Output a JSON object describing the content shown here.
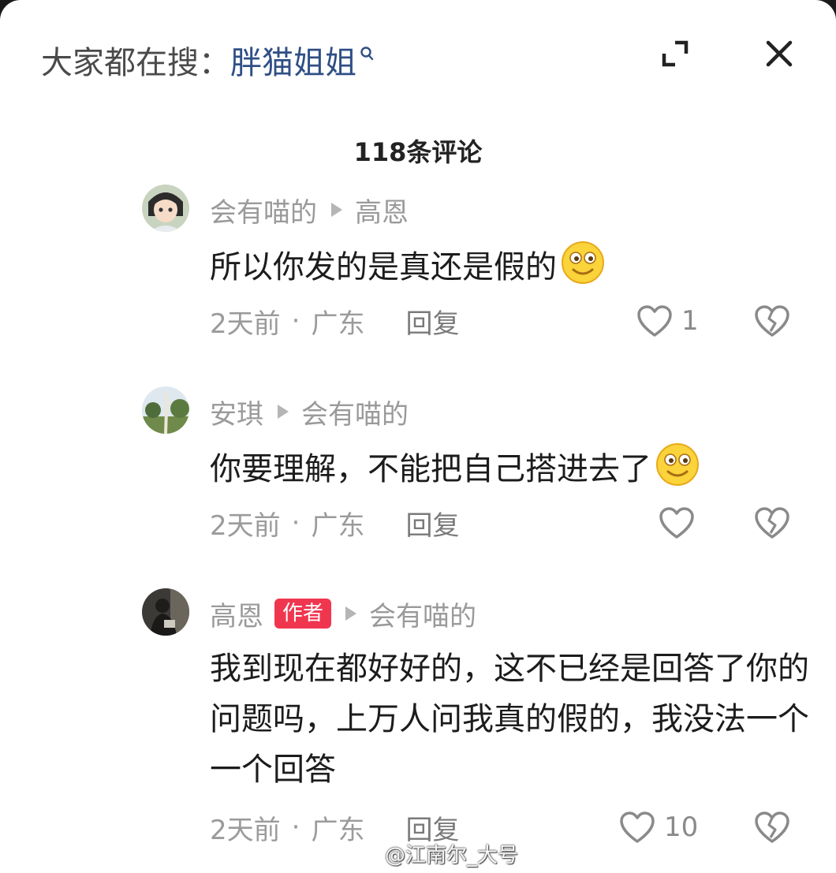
{
  "header": {
    "search_prefix": "大家都在搜：",
    "search_keyword": "胖猫姐姐"
  },
  "comment_count_title": "118条评论",
  "comments": [
    {
      "author": "会有喵的",
      "reply_to": "高恩",
      "text": "所以你发的是真还是假的",
      "time": "2天前",
      "location": "广东",
      "reply_label": "回复",
      "likes": "1",
      "avatar_icon": "anime-girl-avatar"
    },
    {
      "author": "安琪",
      "reply_to": "会有喵的",
      "text": "你要理解，不能把自己搭进去了",
      "time": "2天前",
      "location": "广东",
      "reply_label": "回复",
      "likes": "",
      "avatar_icon": "tree-landscape-avatar"
    },
    {
      "author": "高恩",
      "badge": "作者",
      "reply_to": "会有喵的",
      "text": "我到现在都好好的，这不已经是回答了你的问题吗，上万人问我真的假的，我没法一个一个回答",
      "time": "2天前",
      "location": "广东",
      "reply_label": "回复",
      "likes": "10",
      "avatar_icon": "dark-photo-avatar"
    }
  ],
  "separator": "·",
  "watermark": "@江南尔_大号",
  "colors": {
    "keyword": "#2f4f86",
    "badge": "#f0364f",
    "meta": "#9b9b9b"
  }
}
